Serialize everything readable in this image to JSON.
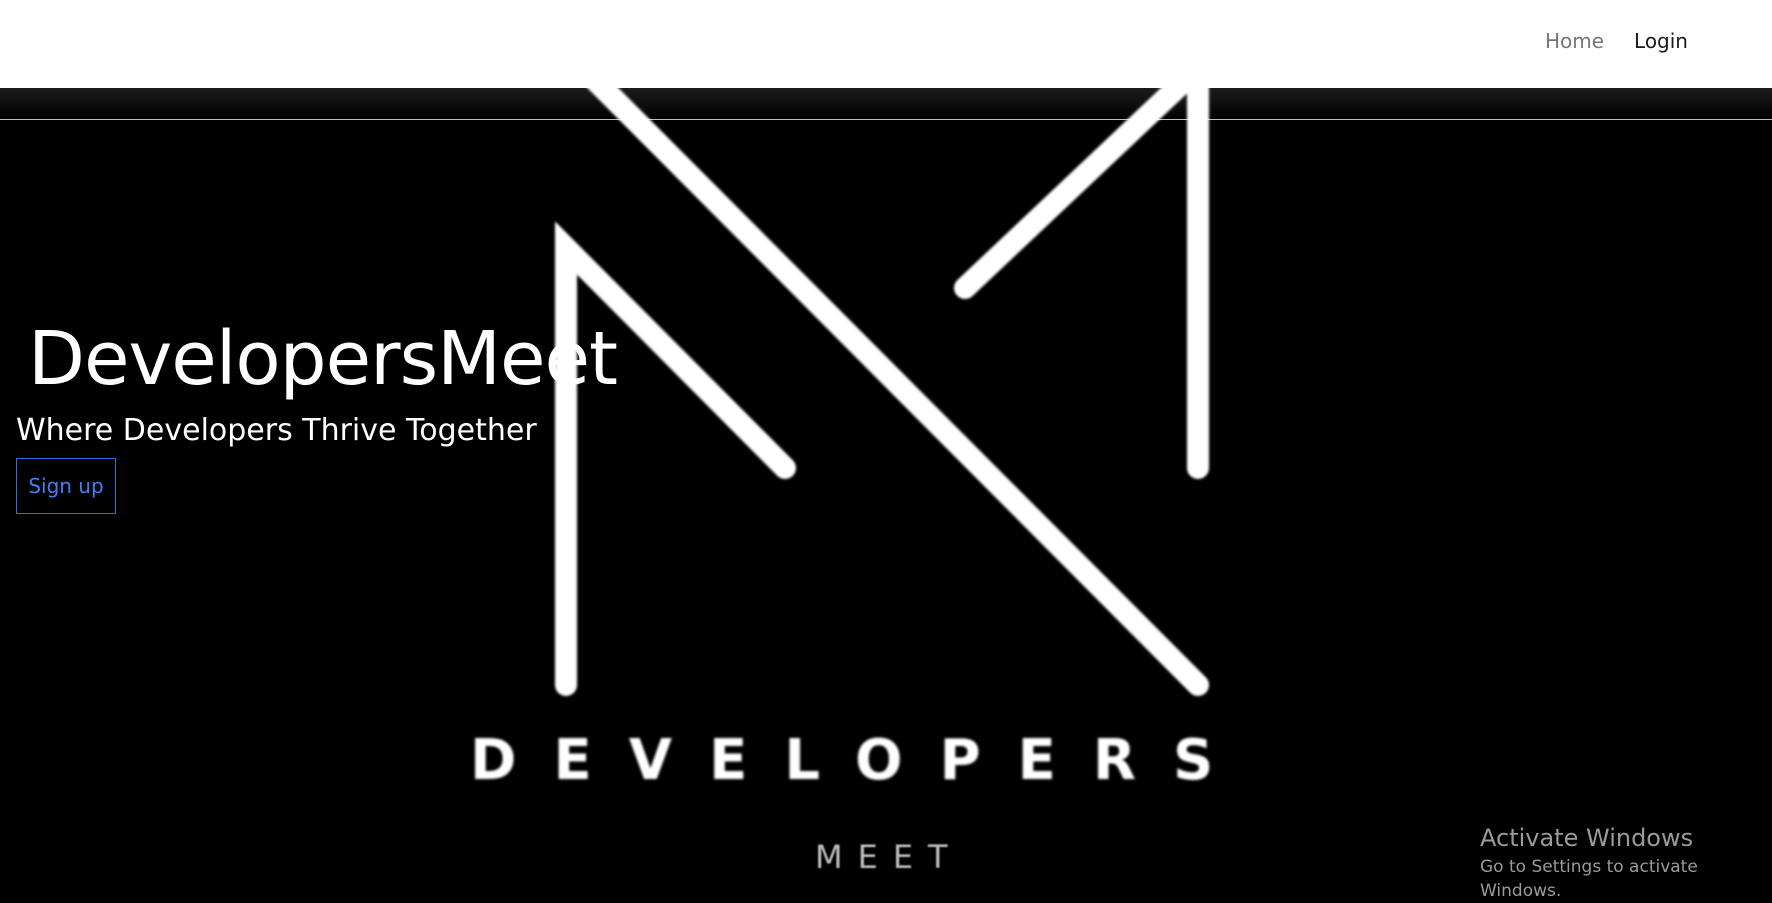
{
  "nav": {
    "home_label": "Home",
    "login_label": "Login"
  },
  "hero": {
    "title": "DevelopersMeet",
    "tagline": "Where Developers Thrive Together",
    "signup_label": "Sign up"
  },
  "logo": {
    "wordmark": "DEVELOPERS",
    "sub": "MEET"
  },
  "watermark": {
    "title": "Activate Windows",
    "subtitle": "Go to Settings to activate Windows."
  },
  "colors": {
    "nav_background": "#ffffff",
    "hero_background": "#000000",
    "signup_accent": "#3c82f6",
    "nav_home": "#777777",
    "nav_login": "#1a1a1a"
  }
}
